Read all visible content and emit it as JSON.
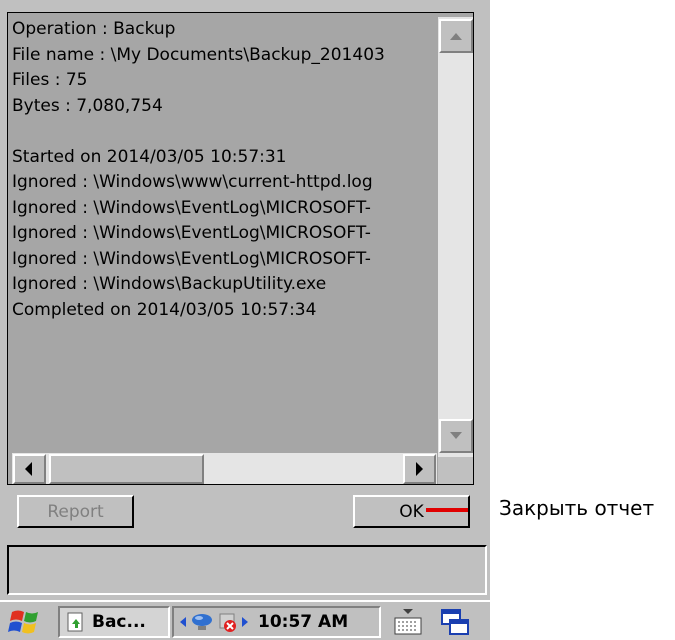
{
  "log": {
    "lines": [
      "Operation : Backup",
      "File name : \\My Documents\\Backup_201403",
      "Files : 75",
      "Bytes : 7,080,754",
      "",
      "Started on 2014/03/05 10:57:31",
      "Ignored : \\Windows\\www\\current-httpd.log",
      "Ignored : \\Windows\\EventLog\\MICROSOFT-",
      "Ignored : \\Windows\\EventLog\\MICROSOFT-",
      "Ignored : \\Windows\\EventLog\\MICROSOFT-",
      "Ignored : \\Windows\\BackupUtility.exe",
      "Completed on 2014/03/05 10:57:34"
    ]
  },
  "buttons": {
    "report_label": "Report",
    "ok_label": "OK"
  },
  "taskbar": {
    "task_label": "Bac...",
    "clock": "10:57 AM"
  },
  "annotation": {
    "label": "Закрыть отчет",
    "color": "#e00000"
  }
}
